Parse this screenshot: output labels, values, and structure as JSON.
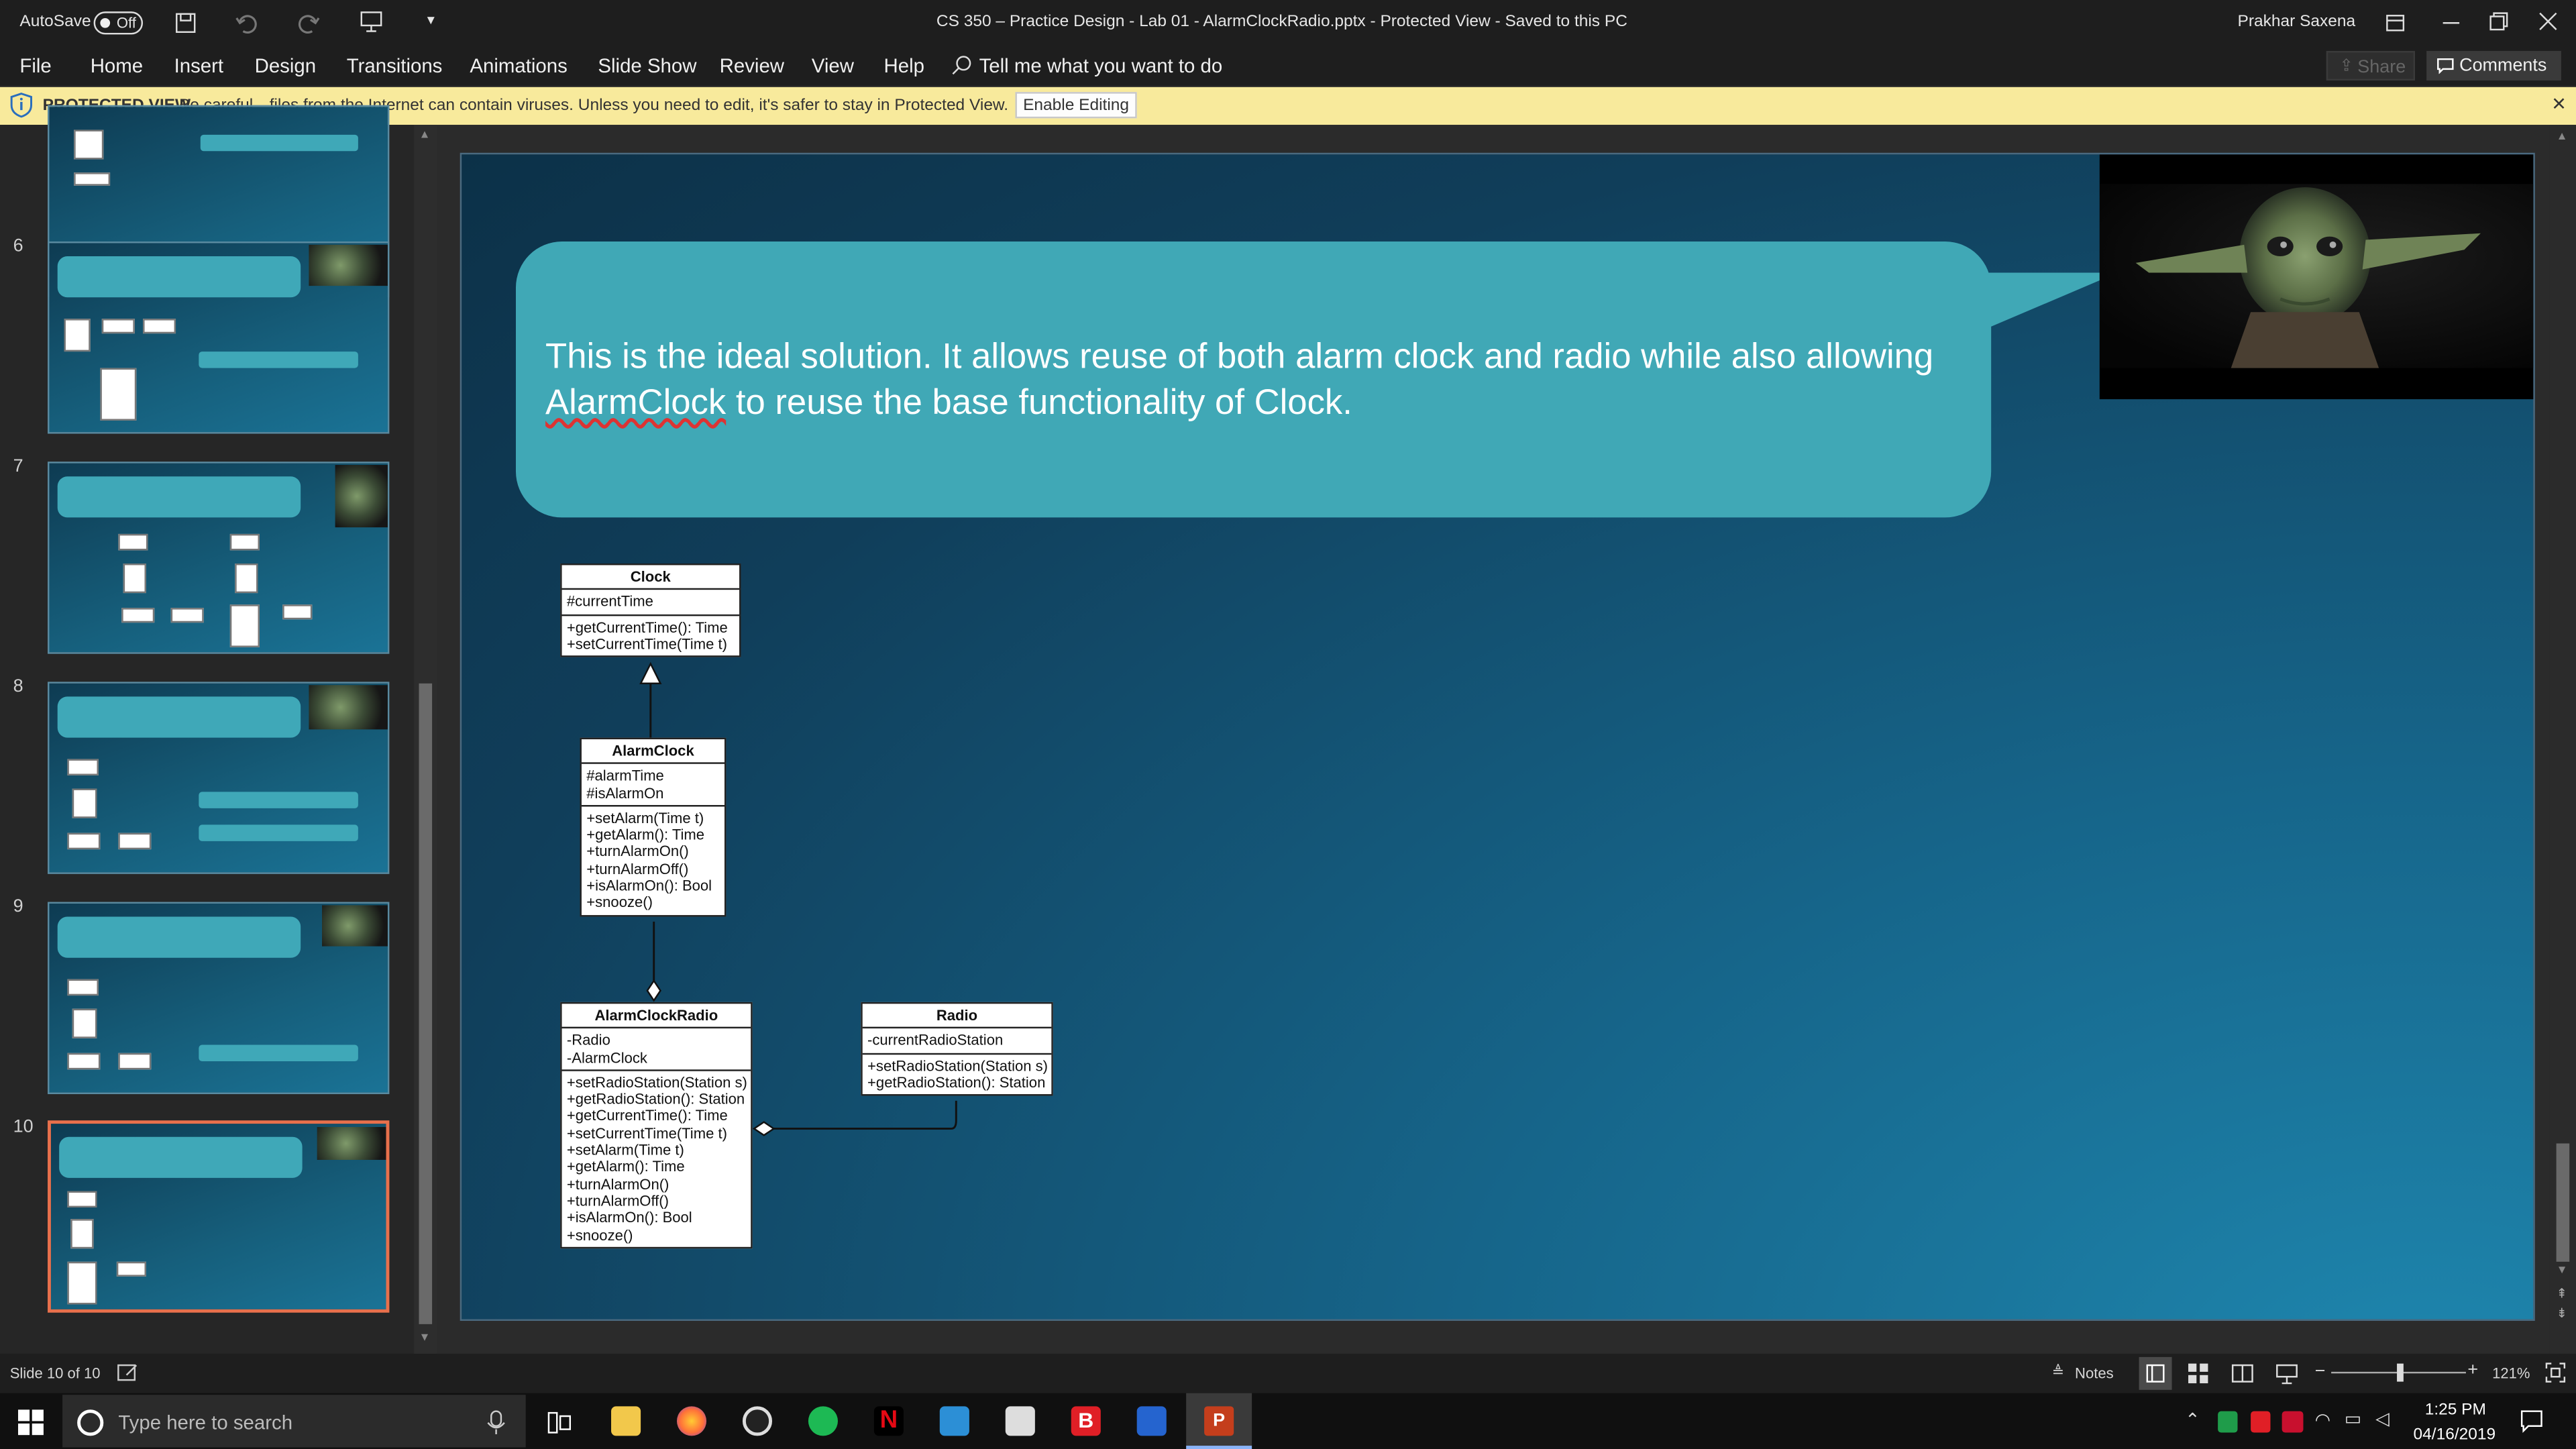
{
  "titlebar": {
    "autosave_label": "AutoSave",
    "autosave_state": "Off",
    "document_title": "CS 350 – Practice Design - Lab 01 - AlarmClockRadio.pptx  -  Protected View  -  Saved to this PC",
    "user_name": "Prakhar Saxena"
  },
  "menu": {
    "items": [
      "File",
      "Home",
      "Insert",
      "Design",
      "Transitions",
      "Animations",
      "Slide Show",
      "Review",
      "View",
      "Help"
    ],
    "tell_me": "Tell me what you want to do",
    "share": "Share",
    "comments": "Comments"
  },
  "protected_view": {
    "label": "PROTECTED VIEW",
    "message": "Be careful—files from the Internet can contain viruses. Unless you need to edit, it's safer to stay in Protected View.",
    "button": "Enable Editing"
  },
  "thumbnails": [
    {
      "number": ""
    },
    {
      "number": "6"
    },
    {
      "number": "7"
    },
    {
      "number": "8"
    },
    {
      "number": "9"
    },
    {
      "number": "10"
    }
  ],
  "slide": {
    "bubble_text_pre": "This is the ideal solution. It allows reuse of both alarm clock and radio while also allowing ",
    "bubble_text_underlined": "AlarmClock",
    "bubble_text_post": " to reuse the base functionality of Clock.",
    "uml": {
      "clock": {
        "name": "Clock",
        "attributes": "#currentTime",
        "methods": "+getCurrentTime(): Time\n+setCurrentTime(Time t)"
      },
      "alarmclock": {
        "name": "AlarmClock",
        "attributes": "#alarmTime\n#isAlarmOn",
        "methods": "+setAlarm(Time t)\n+getAlarm(): Time\n+turnAlarmOn()\n+turnAlarmOff()\n+isAlarmOn(): Bool\n+snooze()"
      },
      "alarmclockradio": {
        "name": "AlarmClockRadio",
        "attributes": "-Radio\n-AlarmClock",
        "methods": "+setRadioStation(Station s)\n+getRadioStation(): Station\n+getCurrentTime(): Time\n+setCurrentTime(Time t)\n+setAlarm(Time t)\n+getAlarm(): Time\n+turnAlarmOn()\n+turnAlarmOff()\n+isAlarmOn(): Bool\n+snooze()"
      },
      "radio": {
        "name": "Radio",
        "attributes": "-currentRadioStation",
        "methods": "+setRadioStation(Station s)\n+getRadioStation(): Station"
      }
    }
  },
  "status": {
    "slide_counter": "Slide 10 of 10",
    "notes": "Notes",
    "zoom": "121%"
  },
  "taskbar": {
    "search_placeholder": "Type here to search",
    "time": "1:25 PM",
    "date": "04/16/2019"
  },
  "colors": {
    "bubble": "#40a8b6",
    "protected_bar": "#f8ea9c",
    "selected_thumb": "#e8704c",
    "powerpoint": "#c43e1c"
  }
}
